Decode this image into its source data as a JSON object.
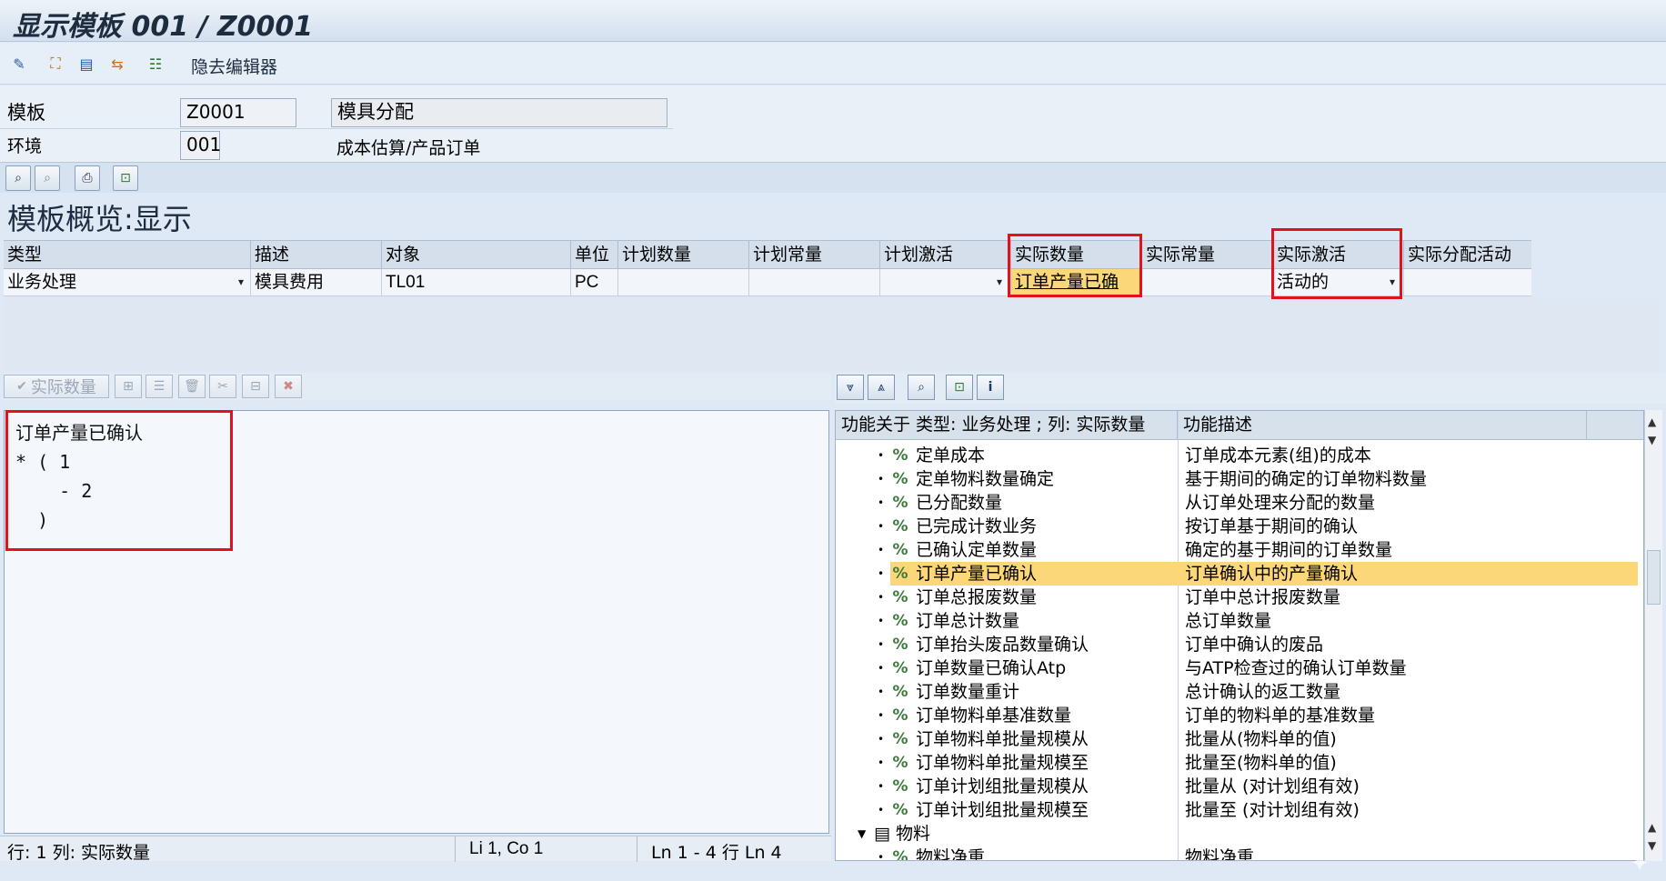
{
  "window": {
    "title": "显示模板 001 / Z0001"
  },
  "toolbar": {
    "hide_editor_label": "隐去编辑器"
  },
  "header": {
    "template_label": "模板",
    "template_value": "Z0001",
    "template_desc": "模具分配",
    "env_label": "环境",
    "env_value": "001",
    "env_desc": "成本估算/产品订单"
  },
  "overview": {
    "title": "模板概览:显示"
  },
  "grid": {
    "columns": [
      "类型",
      "描述",
      "对象",
      "单位",
      "计划数量",
      "计划常量",
      "计划激活",
      "实际数量",
      "实际常量",
      "实际激活",
      "实际分配活动"
    ],
    "row": {
      "type": "业务处理",
      "desc": "模具费用",
      "object": "TL01",
      "unit": "PC",
      "plan_qty": "",
      "plan_const": "",
      "plan_active": "",
      "actual_qty": "订单产量已确",
      "actual_const": "",
      "actual_active": "活动的",
      "actual_alloc": ""
    }
  },
  "editor_toolbar": {
    "check_label": "实际数量"
  },
  "editor": {
    "lines": [
      "订单产量已确认",
      "* ( 1",
      "    - 2",
      "  )"
    ]
  },
  "status": {
    "row_col": "行:  1 列: 实际数量",
    "position": "Li 1, Co 1",
    "range": "Ln 1 - 4 行 Ln 4"
  },
  "functions": {
    "head_left": "功能关于 类型: 业务处理 ; 列: 实际数量",
    "head_right": "功能描述",
    "rows": [
      {
        "name": "定单成本",
        "desc": "订单成本元素(组)的成本"
      },
      {
        "name": "定单物料数量确定",
        "desc": "基于期间的确定的订单物料数量"
      },
      {
        "name": "已分配数量",
        "desc": "从订单处理来分配的数量"
      },
      {
        "name": "已完成计数业务",
        "desc": "按订单基于期间的确认"
      },
      {
        "name": "已确认定单数量",
        "desc": "确定的基于期间的订单数量"
      },
      {
        "name": "订单产量已确认",
        "desc": "订单确认中的产量确认"
      },
      {
        "name": "订单总报废数量",
        "desc": "订单中总计报废数量"
      },
      {
        "name": "订单总计数量",
        "desc": "总订单数量"
      },
      {
        "name": "订单抬头废品数量确认",
        "desc": "订单中确认的废品"
      },
      {
        "name": "订单数量已确认Atp",
        "desc": "与ATP检查过的确认订单数量"
      },
      {
        "name": "订单数量重计",
        "desc": "总计确认的返工数量"
      },
      {
        "name": "订单物料单基准数量",
        "desc": "订单的物料单的基准数量"
      },
      {
        "name": "订单物料单批量规模从",
        "desc": "批量从(物料单的值)"
      },
      {
        "name": "订单物料单批量规模至",
        "desc": "批量至(物料单的值)"
      },
      {
        "name": "订单计划组批量规模从",
        "desc": "批量从 (对计划组有效)"
      },
      {
        "name": "订单计划组批量规模至",
        "desc": "批量至 (对计划组有效)"
      }
    ],
    "folder": "物料",
    "last_row": {
      "name": "物料净重",
      "desc": "物料净重"
    }
  },
  "colors": {
    "highlight": "#fbd77a",
    "red_box": "#e0121b"
  }
}
